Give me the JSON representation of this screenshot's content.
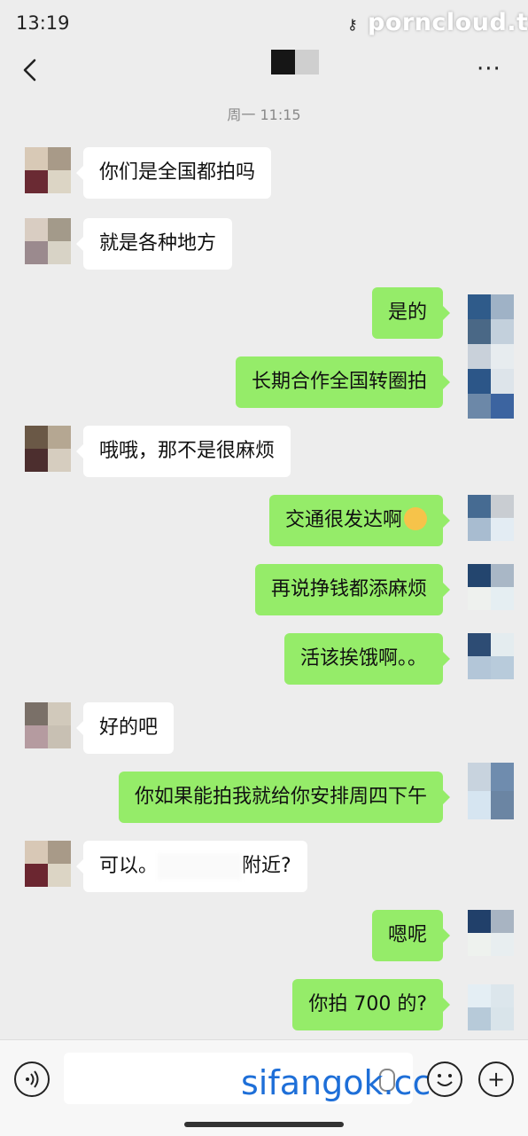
{
  "status": {
    "time": "13:19",
    "watermark": "porncloud.tv"
  },
  "nav": {
    "back_icon": "chevron-left-icon",
    "more_icon": "more-dots-icon",
    "more_label": "···"
  },
  "timestamp": "周一 11:15",
  "messages": [
    {
      "side": "in",
      "text": "你们是全国都拍吗"
    },
    {
      "side": "in",
      "text": "就是各种地方"
    },
    {
      "side": "out",
      "text": "是的"
    },
    {
      "side": "out",
      "text": "长期合作全国转圈拍"
    },
    {
      "side": "in",
      "text": "哦哦，那不是很麻烦"
    },
    {
      "side": "out",
      "text": "交通很发达啊"
    },
    {
      "side": "out",
      "text": "再说挣钱都添麻烦"
    },
    {
      "side": "out",
      "text": "活该挨饿啊。。"
    },
    {
      "side": "in",
      "text": "好的吧"
    },
    {
      "side": "out",
      "text": "你如果能拍我就给你安排周四下午"
    },
    {
      "side": "in",
      "text_start": "可以。",
      "text_end": "附近?"
    },
    {
      "side": "out",
      "text": "嗯呢"
    },
    {
      "side": "out",
      "text": "你拍 700 的?"
    }
  ],
  "emoji_name": "kissing-face-emoji",
  "input": {
    "voice_icon": "voice-icon",
    "emoji_icon": "emoji-icon",
    "plus_icon": "plus-icon",
    "plus_label": "+",
    "watermark": "sifangok.cc"
  },
  "colors": {
    "background": "#ededed",
    "outgoing_bubble": "#95ec69",
    "incoming_bubble": "#ffffff"
  }
}
